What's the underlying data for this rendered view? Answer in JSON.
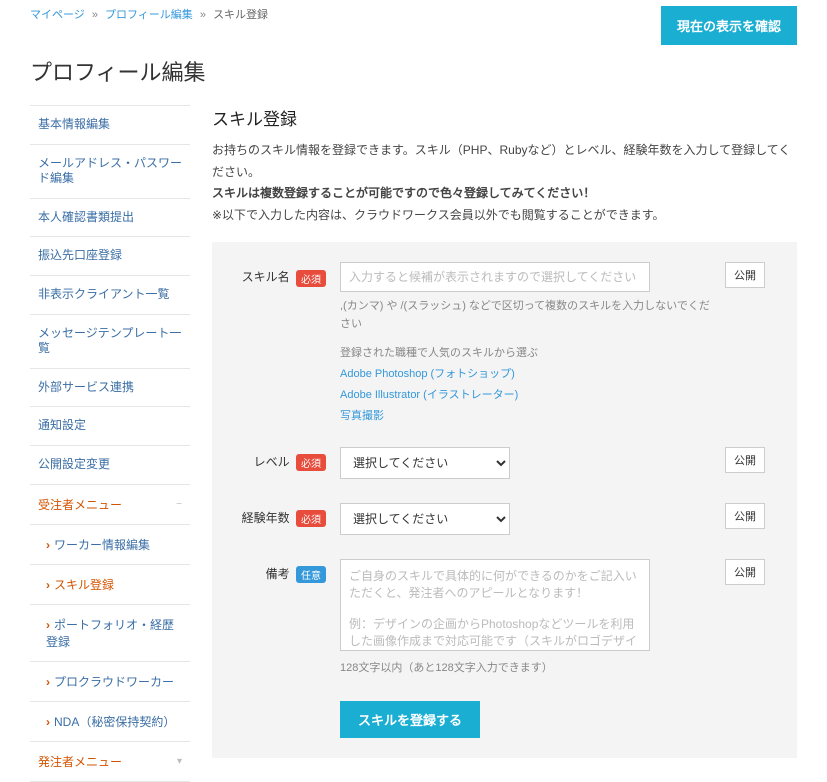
{
  "breadcrumbs": {
    "items": [
      "マイページ",
      "プロフィール編集",
      "スキル登録"
    ]
  },
  "topbar": {
    "confirm_button": "現在の表示を確認"
  },
  "page_title": "プロフィール編集",
  "sidebar": {
    "items": [
      "基本情報編集",
      "メールアドレス・パスワード編集",
      "本人確認書類提出",
      "振込先口座登録",
      "非表示クライアント一覧",
      "メッセージテンプレート一覧",
      "外部サービス連携",
      "通知設定",
      "公開設定変更"
    ],
    "group_orderer": "受注者メニュー",
    "sub": [
      {
        "label": "ワーカー情報編集",
        "active": false
      },
      {
        "label": "スキル登録",
        "active": true
      },
      {
        "label": "ポートフォリオ・経歴登録",
        "active": false
      },
      {
        "label": "プロクラウドワーカー",
        "active": false
      },
      {
        "label": "NDA（秘密保持契約）",
        "active": false
      }
    ],
    "group_client": "発注者メニュー"
  },
  "section": {
    "title": "スキル登録",
    "desc1": "お持ちのスキル情報を登録できます。スキル（PHP、Rubyなど）とレベル、経験年数を入力して登録してください。",
    "desc2": "スキルは複数登録することが可能ですので色々登録してみてください！",
    "desc3": "※以下で入力した内容は、クラウドワークス会員以外でも閲覧することができます。"
  },
  "badges": {
    "required": "必須",
    "optional": "任意"
  },
  "kokai_label": "公開",
  "form": {
    "skill": {
      "label": "スキル名",
      "placeholder": "入力すると候補が表示されますので選択してください",
      "help": ",(カンマ) や /(スラッシュ) などで区切って複数のスキルを入力しないでください",
      "pop_head": "登録された職種で人気のスキルから選ぶ",
      "pop_links": [
        "Adobe Photoshop (フォトショップ)",
        "Adobe Illustrator (イラストレーター)",
        "写真撮影"
      ]
    },
    "level": {
      "label": "レベル",
      "select_default": "選択してください"
    },
    "years": {
      "label": "経験年数",
      "select_default": "選択してください"
    },
    "note": {
      "label": "備考",
      "placeholder": "ご自身のスキルで具体的に何ができるのかをご記入いただくと、発注者へのアピールとなります！\n\n例：デザインの企画からPhotoshopなどツールを利用した画像作成まで対応可能です（スキルがロゴデザインの場合）",
      "counter": "128文字以内（あと128文字入力できます）"
    },
    "submit": "スキルを登録する"
  }
}
